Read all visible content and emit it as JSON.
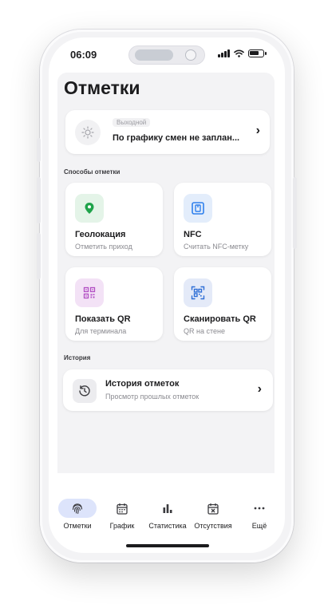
{
  "status_bar": {
    "time": "06:09"
  },
  "page": {
    "title": "Отметки"
  },
  "shift": {
    "badge": "Выходной",
    "text": "По графику смен не заплан..."
  },
  "methods": {
    "section_label": "Способы отметки",
    "items": [
      {
        "title": "Геолокация",
        "subtitle": "Отметить приход",
        "icon": "location-pin-icon",
        "color": "#1fa34a",
        "bg": "#e4f4e8"
      },
      {
        "title": "NFC",
        "subtitle": "Считать NFC-метку",
        "icon": "nfc-icon",
        "color": "#2f80ed",
        "bg": "#e3edfb"
      },
      {
        "title": "Показать QR",
        "subtitle": "Для терминала",
        "icon": "qr-code-icon",
        "color": "#b24fc4",
        "bg": "#f3e2f6"
      },
      {
        "title": "Сканировать QR",
        "subtitle": "QR на стене",
        "icon": "qr-scan-icon",
        "color": "#2f6fd6",
        "bg": "#e4eaf8"
      }
    ]
  },
  "history": {
    "section_label": "История",
    "title": "История отметок",
    "subtitle": "Просмотр прошлых отметок"
  },
  "tabs": [
    {
      "label": "Отметки",
      "icon": "fingerprint-icon",
      "active": true
    },
    {
      "label": "График",
      "icon": "calendar-icon",
      "active": false
    },
    {
      "label": "Статистика",
      "icon": "bar-chart-icon",
      "active": false
    },
    {
      "label": "Отсутствия",
      "icon": "calendar-x-icon",
      "active": false
    },
    {
      "label": "Ещё",
      "icon": "more-icon",
      "active": false
    }
  ],
  "colors": {
    "accent": "#dde4fb",
    "background": "#f3f3f5"
  }
}
